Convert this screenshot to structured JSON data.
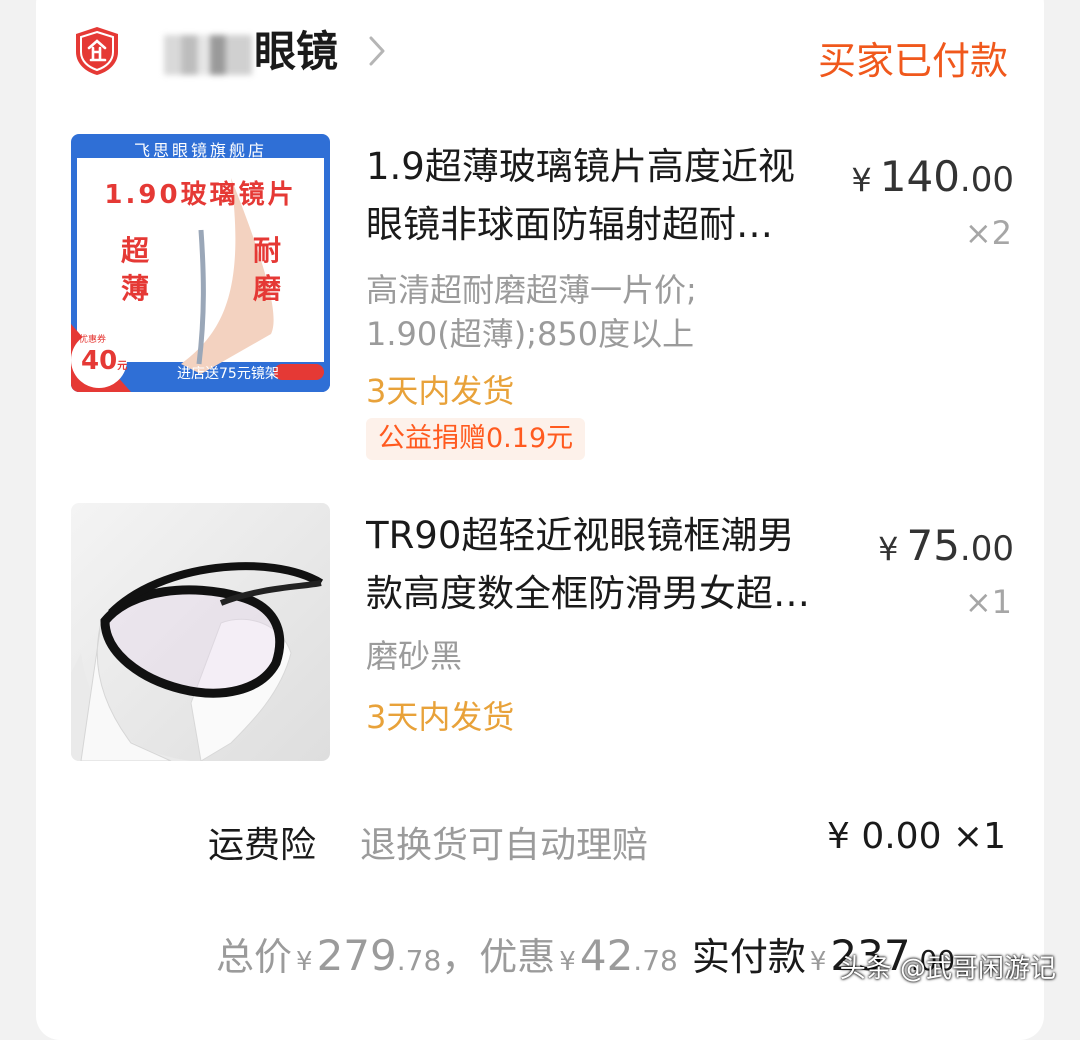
{
  "header": {
    "shop_name_visible": "眼镜",
    "status": "买家已付款"
  },
  "thumb1": {
    "banner_store": "飞思眼镜旗舰店",
    "banner_title": "1.90玻璃镜片",
    "left_words": "超 薄",
    "right_words": "耐 磨",
    "coupon_label": "优惠券",
    "coupon_value": "40",
    "coupon_unit": "元",
    "footer_text": "进店送75元镜架"
  },
  "items": [
    {
      "title_line1": "1.9超薄玻璃镜片高度近视",
      "title_line2": "眼镜非球面防辐射超耐…",
      "sku_line1": "高清超耐磨超薄一片价;",
      "sku_line2": "1.90(超薄);850度以上",
      "shipping": "3天内发货",
      "charity": "公益捐赠0.19元",
      "currency": "¥",
      "price_int": "140",
      "price_dec": ".00",
      "qty": "×2"
    },
    {
      "title_line1": "TR90超轻近视眼镜框潮男",
      "title_line2": "款高度数全框防滑男女超…",
      "sku_line1": "磨砂黑",
      "shipping": "3天内发货",
      "currency": "¥",
      "price_int": "75",
      "price_dec": ".00",
      "qty": "×1"
    }
  ],
  "insurance": {
    "label": "运费险",
    "desc": "退换货可自动理赔",
    "price": "¥ 0.00 ×1"
  },
  "totals": {
    "total_label": "总价",
    "currency": "¥",
    "total_int": "279",
    "total_dec": ".78",
    "sep": "，",
    "discount_label": "优惠",
    "discount_int": "42",
    "discount_dec": ".78",
    "paid_label": "实付款",
    "paid_int": "237",
    "paid_dec": ".00"
  },
  "watermark": "头条 @武哥闲游记",
  "colors": {
    "accent": "#f0581c",
    "shipping": "#e8a23a",
    "muted": "#9b9b9b",
    "badge_red": "#e53935"
  }
}
